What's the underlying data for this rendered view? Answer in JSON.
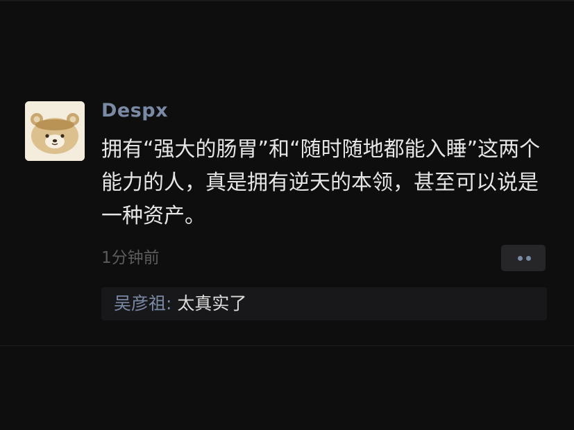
{
  "post": {
    "nickname": "Despx",
    "avatar_icon": "bear-avatar",
    "content": "拥有“强大的肠胃”和“随时随地都能入睡”这两个能力的人，真是拥有逆天的本领，甚至可以说是一种资产。",
    "timestamp": "1分钟前",
    "action_icon": "more-dots-icon"
  },
  "comments": [
    {
      "author": "吴彦祖",
      "separator": ": ",
      "text": "太真实了"
    }
  ],
  "colors": {
    "background": "#0e0e0f",
    "nickname": "#7a8aa5",
    "text": "#e6e6e6",
    "timestamp": "#5c5c5e",
    "comment_bg": "#18181a"
  }
}
